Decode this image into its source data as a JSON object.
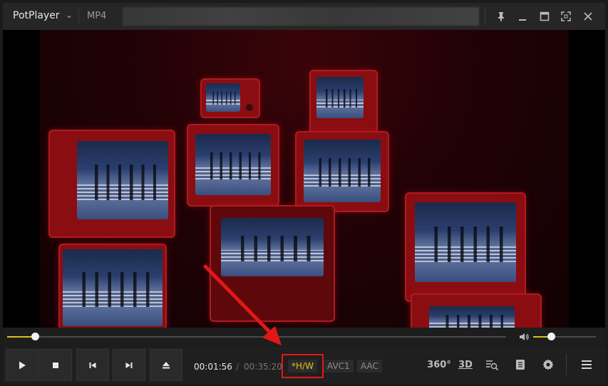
{
  "titlebar": {
    "app_name": "PotPlayer",
    "format": "MP4"
  },
  "playback": {
    "current_time": "00:01:56",
    "total_time": "00:35:20",
    "separator": "/",
    "seek_progress": 0.055,
    "volume_level": 0.28
  },
  "codec_tags": {
    "hw": "*H/W",
    "video_codec": "AVC1",
    "audio_codec": "AAC"
  },
  "right_controls": {
    "vr_label": "360°",
    "stereo_label": "3D"
  },
  "colors": {
    "accent_yellow": "#d9c21a",
    "highlight_red": "#e31717",
    "tv_red": "#8a0d12"
  },
  "icons": {
    "pin": "pin-icon",
    "minimize": "minimize-icon",
    "maximize": "maximize-icon",
    "fullscreen": "fullscreen-icon",
    "close": "close-icon",
    "play": "play-icon",
    "stop": "stop-icon",
    "prev": "previous-icon",
    "next": "next-icon",
    "eject": "eject-icon",
    "volume": "volume-icon",
    "search_list": "playlist-search-icon",
    "chapters": "chapters-icon",
    "settings": "gear-icon",
    "menu": "menu-icon"
  }
}
